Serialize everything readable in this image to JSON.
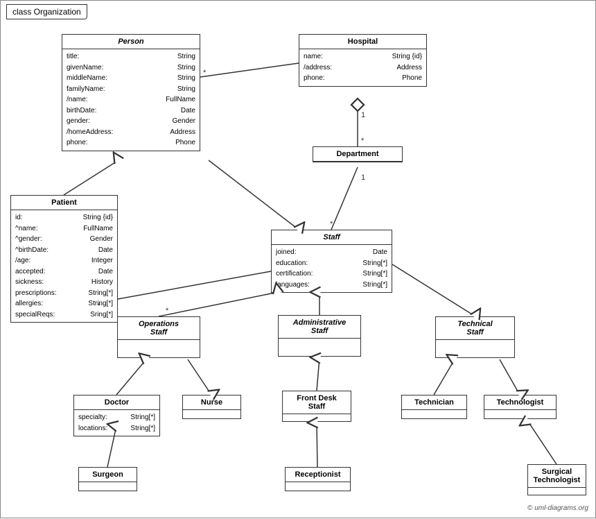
{
  "title": "class Organization",
  "classes": {
    "person": {
      "name": "Person",
      "italic": true,
      "attrs": [
        [
          "title:",
          "String"
        ],
        [
          "givenName:",
          "String"
        ],
        [
          "middleName:",
          "String"
        ],
        [
          "familyName:",
          "String"
        ],
        [
          "/name:",
          "FullName"
        ],
        [
          "birthDate:",
          "Date"
        ],
        [
          "gender:",
          "Gender"
        ],
        [
          "/homeAddress:",
          "Address"
        ],
        [
          "phone:",
          "Phone"
        ]
      ]
    },
    "hospital": {
      "name": "Hospital",
      "italic": false,
      "attrs": [
        [
          "name:",
          "String {id}"
        ],
        [
          "/address:",
          "Address"
        ],
        [
          "phone:",
          "Phone"
        ]
      ]
    },
    "department": {
      "name": "Department",
      "italic": false,
      "attrs": []
    },
    "staff": {
      "name": "Staff",
      "italic": true,
      "attrs": [
        [
          "joined:",
          "Date"
        ],
        [
          "education:",
          "String[*]"
        ],
        [
          "certification:",
          "String[*]"
        ],
        [
          "languages:",
          "String[*]"
        ]
      ]
    },
    "patient": {
      "name": "Patient",
      "italic": false,
      "attrs": [
        [
          "id:",
          "String {id}"
        ],
        [
          "^name:",
          "FullName"
        ],
        [
          "^gender:",
          "Gender"
        ],
        [
          "^birthDate:",
          "Date"
        ],
        [
          "/age:",
          "Integer"
        ],
        [
          "accepted:",
          "Date"
        ],
        [
          "sickness:",
          "History"
        ],
        [
          "prescriptions:",
          "String[*]"
        ],
        [
          "allergies:",
          "String[*]"
        ],
        [
          "specialReqs:",
          "Sring[*]"
        ]
      ]
    },
    "operations_staff": {
      "name": "Operations Staff",
      "italic": true,
      "attrs": []
    },
    "administrative_staff": {
      "name": "Administrative Staff",
      "italic": true,
      "attrs": []
    },
    "technical_staff": {
      "name": "Technical Staff",
      "italic": true,
      "attrs": []
    },
    "doctor": {
      "name": "Doctor",
      "italic": false,
      "attrs": [
        [
          "specialty:",
          "String[*]"
        ],
        [
          "locations:",
          "String[*]"
        ]
      ]
    },
    "nurse": {
      "name": "Nurse",
      "italic": false,
      "attrs": []
    },
    "front_desk_staff": {
      "name": "Front Desk Staff",
      "italic": false,
      "attrs": []
    },
    "technician": {
      "name": "Technician",
      "italic": false,
      "attrs": []
    },
    "technologist": {
      "name": "Technologist",
      "italic": false,
      "attrs": []
    },
    "surgeon": {
      "name": "Surgeon",
      "italic": false,
      "attrs": []
    },
    "receptionist": {
      "name": "Receptionist",
      "italic": false,
      "attrs": []
    },
    "surgical_technologist": {
      "name": "Surgical Technologist",
      "italic": false,
      "attrs": []
    }
  },
  "copyright": "© uml-diagrams.org"
}
